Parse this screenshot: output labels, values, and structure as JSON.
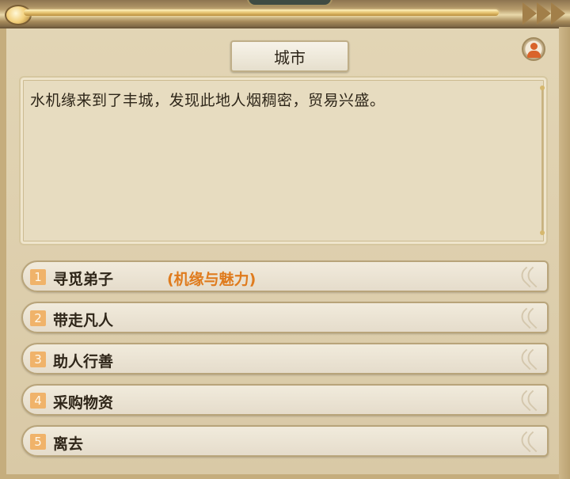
{
  "dialog": {
    "title": "城市",
    "story": "水机缘来到了丰城，发现此地人烟稠密，贸易兴盛。"
  },
  "options": [
    {
      "number": "1",
      "label": "寻觅弟子",
      "extra": "(机缘与魅力)"
    },
    {
      "number": "2",
      "label": "带走凡人"
    },
    {
      "number": "3",
      "label": "助人行善"
    },
    {
      "number": "4",
      "label": "采购物资"
    },
    {
      "number": "5",
      "label": "离去"
    }
  ],
  "colors": {
    "number_badge": "#f0b36a",
    "highlight_text": "#df7b1d",
    "avatar_figure": "#d9632a"
  },
  "icons": {
    "avatar": "person-avatar-icon",
    "option_chevron": "double-chevron-icon"
  }
}
